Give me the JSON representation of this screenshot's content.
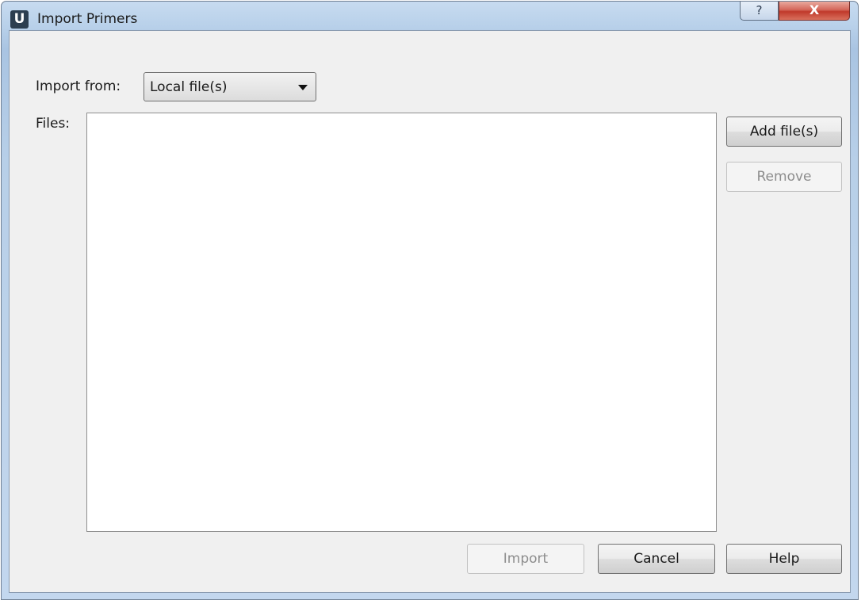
{
  "window": {
    "title": "Import Primers",
    "app_icon_letter": "U",
    "help_glyph": "?",
    "close_glyph": "X"
  },
  "form": {
    "import_from_label": "Import from:",
    "import_from_value": "Local file(s)",
    "files_label": "Files:",
    "files": []
  },
  "buttons": {
    "add_files": "Add file(s)",
    "remove": "Remove",
    "import": "Import",
    "cancel": "Cancel",
    "help": "Help"
  },
  "state": {
    "remove_enabled": false,
    "import_enabled": false
  }
}
